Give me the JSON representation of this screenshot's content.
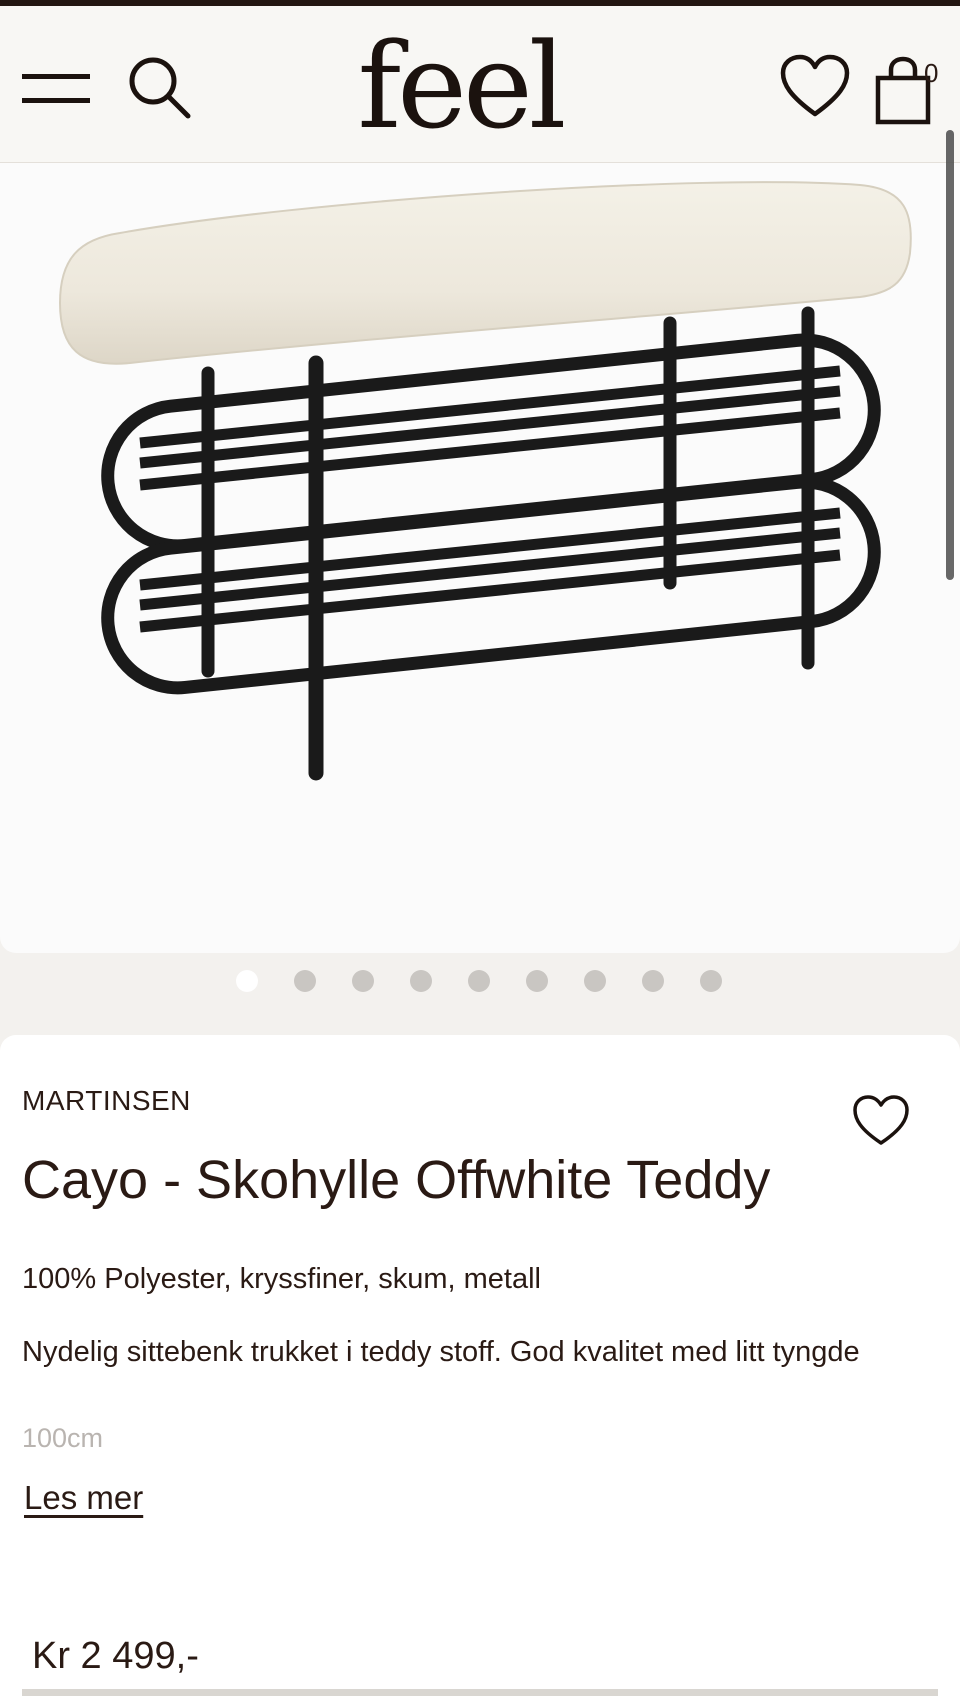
{
  "header": {
    "logo": "feel",
    "cart_count": "0",
    "icons": [
      "menu-icon",
      "search-icon",
      "heart-icon",
      "shopping-bag-icon"
    ]
  },
  "gallery": {
    "image_count": 9,
    "active_index": 0
  },
  "product": {
    "brand": "MARTINSEN",
    "title": "Cayo - Skohylle Offwhite Teddy",
    "materials": "100% Polyester, kryssfiner, skum, metall",
    "description": "Nydelig sittebenk trukket i teddy stoff. God kvalitet med litt tyngde",
    "dimension": "100cm",
    "read_more": "Les mer",
    "price": "Kr 2 499,-"
  },
  "colors": {
    "accent": "#2a1a14",
    "page_bg": "#f3f1ee",
    "cushion": "#efebe0",
    "metal": "#1a1a1a"
  }
}
